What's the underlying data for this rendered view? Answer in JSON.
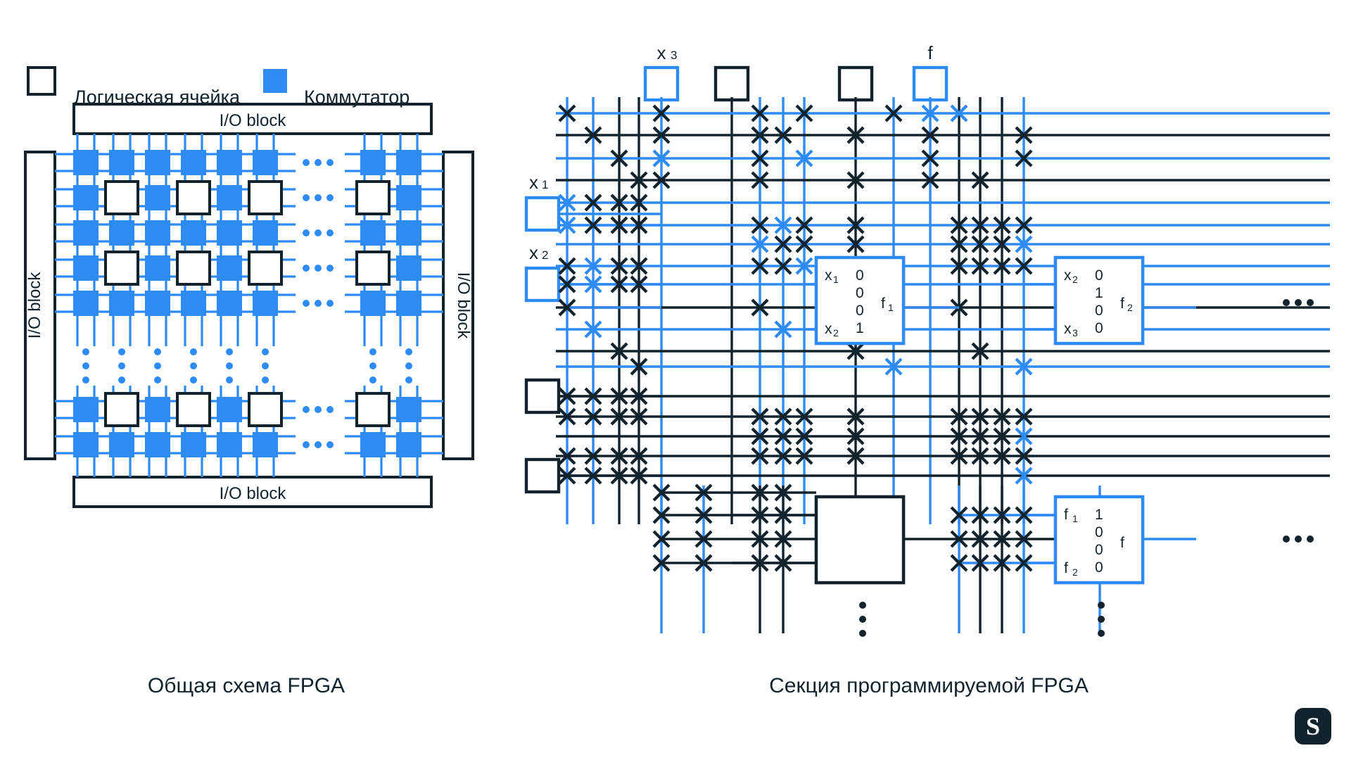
{
  "colors": {
    "blue": "#2f8bf4",
    "dark": "#12232e",
    "white": "#ffffff"
  },
  "legend": {
    "logic_cell_label": "Логическая ячейка",
    "switch_label": "Коммутатор"
  },
  "left_diagram": {
    "caption": "Общая схема FPGA",
    "io_blocks": {
      "top": "I/O block",
      "bottom": "I/O block",
      "left": "I/O block",
      "right": "I/O block"
    },
    "horizontal_ellipsis": "• • •",
    "vertical_ellipsis": "⋮"
  },
  "right_diagram": {
    "caption": "Секция программируемой FPGA",
    "io_pads_top": [
      {
        "label": "x",
        "sub": "3",
        "active": true
      },
      {
        "label": "",
        "sub": "",
        "active": false
      },
      {
        "label": "",
        "sub": "",
        "active": false
      },
      {
        "label": "f",
        "sub": "",
        "active": true
      }
    ],
    "io_pads_left": [
      {
        "label": "x",
        "sub": "1",
        "active": true
      },
      {
        "label": "x",
        "sub": "2",
        "active": true
      },
      {
        "label": "",
        "sub": "",
        "active": false
      },
      {
        "label": "",
        "sub": "",
        "active": false
      }
    ],
    "luts": [
      {
        "id": "lut-f1",
        "active": true,
        "input_top": "x",
        "input_top_sub": "1",
        "input_bottom": "x",
        "input_bottom_sub": "2",
        "truth_table": [
          "0",
          "0",
          "0",
          "1"
        ],
        "output": "f",
        "output_sub": "1"
      },
      {
        "id": "lut-f2",
        "active": true,
        "input_top": "x",
        "input_top_sub": "2",
        "input_bottom": "x",
        "input_bottom_sub": "3",
        "truth_table": [
          "0",
          "1",
          "0",
          "0"
        ],
        "output": "f",
        "output_sub": "2"
      },
      {
        "id": "lut-f",
        "active": true,
        "input_top": "f",
        "input_top_sub": "1",
        "input_bottom": "f",
        "input_bottom_sub": "2",
        "truth_table": [
          "1",
          "0",
          "0",
          "0"
        ],
        "output": "f",
        "output_sub": ""
      },
      {
        "id": "lut-empty",
        "active": false,
        "input_top": "",
        "input_top_sub": "",
        "input_bottom": "",
        "input_bottom_sub": "",
        "truth_table": [],
        "output": "",
        "output_sub": ""
      }
    ],
    "horizontal_ellipsis": "• • •",
    "vertical_ellipsis": "⋮"
  },
  "watermark": {
    "letter": "S"
  }
}
